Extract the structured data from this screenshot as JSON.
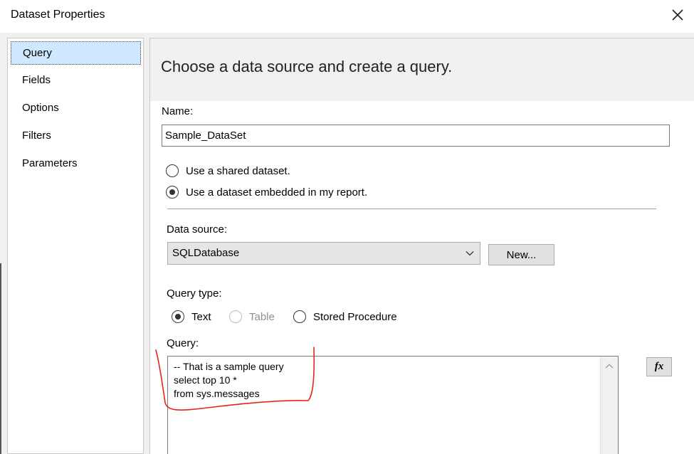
{
  "window": {
    "title": "Dataset Properties"
  },
  "nav": {
    "items": [
      {
        "label": "Query",
        "selected": true
      },
      {
        "label": "Fields",
        "selected": false
      },
      {
        "label": "Options",
        "selected": false
      },
      {
        "label": "Filters",
        "selected": false
      },
      {
        "label": "Parameters",
        "selected": false
      }
    ]
  },
  "main": {
    "header": "Choose a data source and create a query.",
    "name_label": "Name:",
    "name_value": "Sample_DataSet",
    "dataset_options": [
      {
        "label": "Use a shared dataset.",
        "checked": false
      },
      {
        "label": "Use a dataset embedded in my report.",
        "checked": true
      }
    ],
    "data_source_label": "Data source:",
    "data_source_value": "SQLDatabase",
    "new_button": "New...",
    "query_type_label": "Query type:",
    "query_types": [
      {
        "label": "Text",
        "checked": true,
        "disabled": false
      },
      {
        "label": "Table",
        "checked": false,
        "disabled": true
      },
      {
        "label": "Stored Procedure",
        "checked": false,
        "disabled": false
      }
    ],
    "query_label": "Query:",
    "query_text": "-- That is a sample query\nselect top 10 *\nfrom sys.messages",
    "fx_button": "fx"
  },
  "colors": {
    "dialog_bg": "#f0f0f0",
    "selection": "#cde8ff",
    "annotation": "#e8221a"
  },
  "icons": {
    "close": "close-icon",
    "dropdown": "chevron-down-icon",
    "scroll_up": "chevron-up-icon"
  }
}
